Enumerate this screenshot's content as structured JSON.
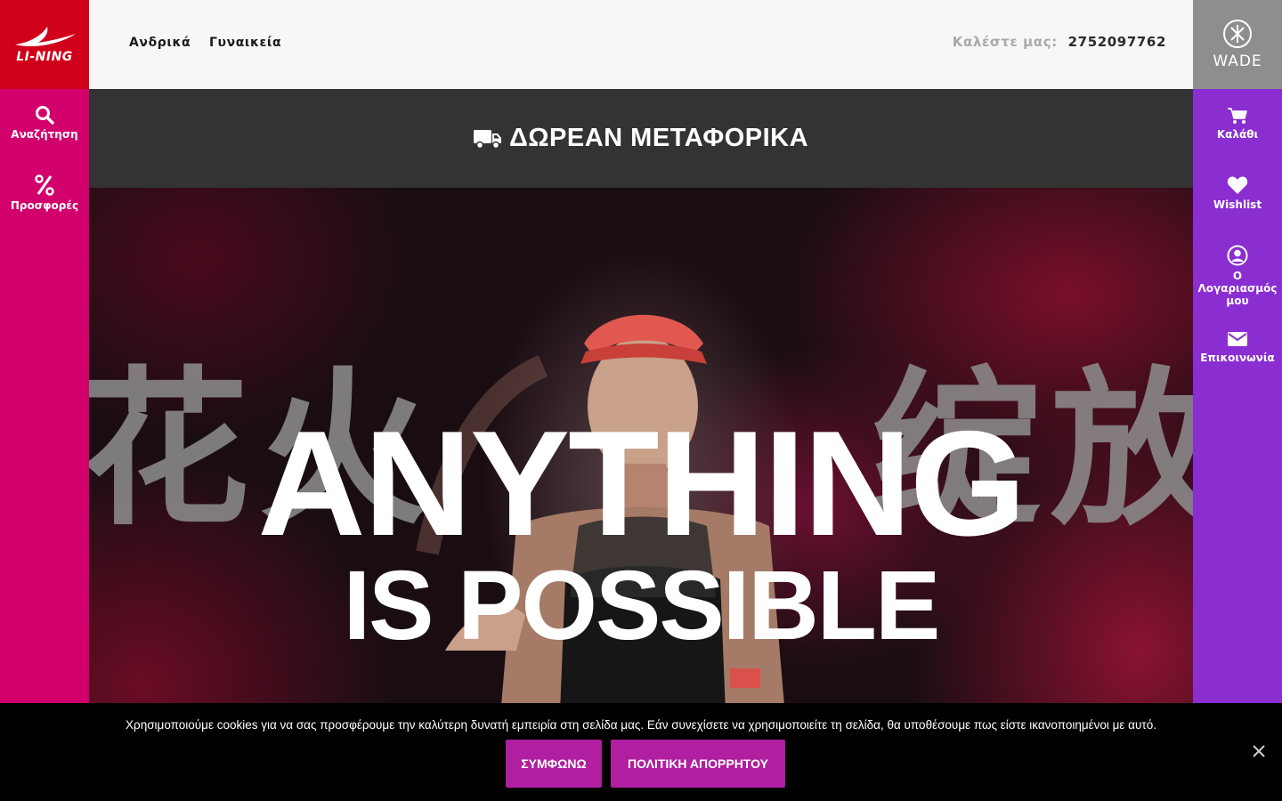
{
  "brand": {
    "logo_text": "LI-NING",
    "color": "#d0021b"
  },
  "header": {
    "nav": [
      {
        "label": "Ανδρικά"
      },
      {
        "label": "Γυναικεία"
      }
    ],
    "phone_label": "Καλέστε μας:",
    "phone_number": "2752097762"
  },
  "wade": {
    "label": "WADE"
  },
  "left_sidebar": {
    "color": "#d1006c",
    "items": [
      {
        "label": "Αναζήτηση",
        "icon": "search-icon"
      },
      {
        "label": "Προσφορές",
        "icon": "percent-icon"
      }
    ]
  },
  "right_sidebar": {
    "color": "#8a2dd1",
    "items": [
      {
        "label": "Καλάθι",
        "icon": "cart-icon"
      },
      {
        "label": "Wishlist",
        "icon": "heart-icon"
      },
      {
        "label": "Ο Λογαριασμός μου",
        "icon": "user-icon"
      },
      {
        "label": "Επικοινωνία",
        "icon": "envelope-icon"
      }
    ]
  },
  "shipping_banner": {
    "title": "ΔΩΡΕΑΝ ΜΕΤΑΦΟΡΙΚΑ",
    "icon": "truck-icon"
  },
  "hero": {
    "line1": "ANYTHING",
    "line2": "IS POSSIBLE",
    "background_glyphs": [
      "花",
      "火",
      "绽",
      "放"
    ]
  },
  "cookie_bar": {
    "text": "Χρησιμοποιούμε cookies για να σας προσφέρουμε την καλύτερη δυνατή εμπειρία στη σελίδα μας. Εάν συνεχίσετε να χρησιμοποιείτε τη σελίδα, θα υποθέσουμε πως είστε ικανοποιημένοι με αυτό.",
    "accept_label": "ΣΥΜΦΩΝΩ",
    "privacy_label": "ΠΟΛΙΤΙΚΗ ΑΠΟΡΡΗΤΟΥ",
    "button_color": "#b01f9f"
  }
}
